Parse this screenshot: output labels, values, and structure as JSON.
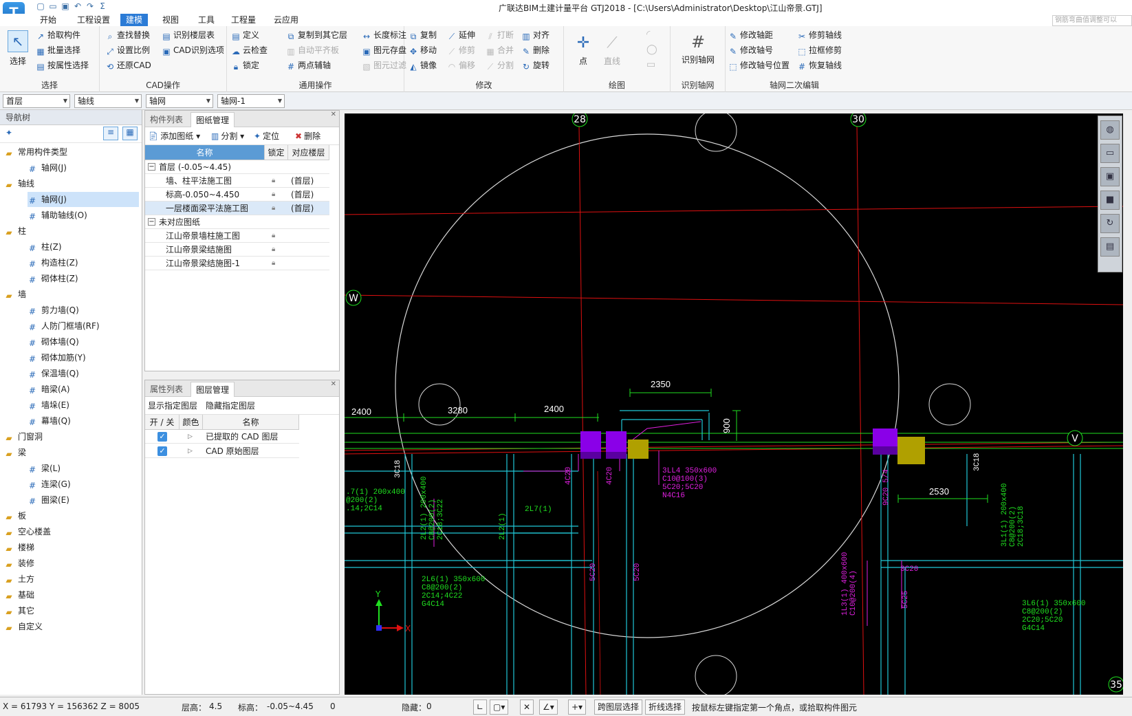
{
  "window": {
    "title": "广联达BIM土建计量平台 GTJ2018 - [C:\\Users\\Administrator\\Desktop\\江山帝景.GTJ]",
    "search_hint": "钢筋弯曲值调整可以"
  },
  "app_logo": "T",
  "menu": [
    "开始",
    "工程设置",
    "建模",
    "视图",
    "工具",
    "工程量",
    "云应用"
  ],
  "ribbon": {
    "select": {
      "big": "选择",
      "items": [
        "拾取构件",
        "批量选择",
        "按属性选择"
      ],
      "label": "选择"
    },
    "cad": {
      "items": [
        "查找替换",
        "识别楼层表",
        "设置比例",
        "CAD识别选项",
        "还原CAD"
      ],
      "label": "CAD操作"
    },
    "common": {
      "items": [
        "定义",
        "复制到其它层",
        "长度标注",
        "云检查",
        "自动平齐板",
        "图元存盘",
        "锁定",
        "两点辅轴",
        "图元过滤"
      ],
      "label": "通用操作"
    },
    "modify": {
      "items": [
        "复制",
        "延伸",
        "打断",
        "对齐",
        "移动",
        "修剪",
        "合并",
        "删除",
        "镜像",
        "偏移",
        "分割",
        "旋转"
      ],
      "label": "修改"
    },
    "draw": {
      "items": [
        "点",
        "直线"
      ],
      "label": "绘图"
    },
    "recog": {
      "big": "识别轴网",
      "label": "识别轴网"
    },
    "axis2": {
      "items": [
        "修改轴距",
        "修剪轴线",
        "修改轴号",
        "拉框修剪",
        "修改轴号位置",
        "恢复轴线"
      ],
      "label": "轴网二次编辑"
    }
  },
  "selectors": [
    "首层",
    "轴线",
    "轴网",
    "轴网-1"
  ],
  "nav": {
    "title": "导航树",
    "items": [
      {
        "label": "常用构件类型",
        "type": "folder"
      },
      {
        "label": "轴网(J)",
        "type": "leaf"
      },
      {
        "label": "轴线",
        "type": "folder"
      },
      {
        "label": "轴网(J)",
        "type": "leaf",
        "selected": true
      },
      {
        "label": "辅助轴线(O)",
        "type": "leaf"
      },
      {
        "label": "柱",
        "type": "folder"
      },
      {
        "label": "柱(Z)",
        "type": "leaf"
      },
      {
        "label": "构造柱(Z)",
        "type": "leaf"
      },
      {
        "label": "砌体柱(Z)",
        "type": "leaf"
      },
      {
        "label": "墙",
        "type": "folder"
      },
      {
        "label": "剪力墙(Q)",
        "type": "leaf"
      },
      {
        "label": "人防门框墙(RF)",
        "type": "leaf"
      },
      {
        "label": "砌体墙(Q)",
        "type": "leaf"
      },
      {
        "label": "砌体加筋(Y)",
        "type": "leaf"
      },
      {
        "label": "保温墙(Q)",
        "type": "leaf"
      },
      {
        "label": "暗梁(A)",
        "type": "leaf"
      },
      {
        "label": "墙垛(E)",
        "type": "leaf"
      },
      {
        "label": "幕墙(Q)",
        "type": "leaf"
      },
      {
        "label": "门窗洞",
        "type": "folder"
      },
      {
        "label": "梁",
        "type": "folder"
      },
      {
        "label": "梁(L)",
        "type": "leaf"
      },
      {
        "label": "连梁(G)",
        "type": "leaf"
      },
      {
        "label": "圈梁(E)",
        "type": "leaf"
      },
      {
        "label": "板",
        "type": "folder"
      },
      {
        "label": "空心楼盖",
        "type": "folder"
      },
      {
        "label": "楼梯",
        "type": "folder"
      },
      {
        "label": "装修",
        "type": "folder"
      },
      {
        "label": "土方",
        "type": "folder"
      },
      {
        "label": "基础",
        "type": "folder"
      },
      {
        "label": "其它",
        "type": "folder"
      },
      {
        "label": "自定义",
        "type": "folder"
      }
    ]
  },
  "drawings_panel": {
    "tabs": [
      "构件列表",
      "图纸管理"
    ],
    "tools": [
      "添加图纸",
      "分割",
      "定位",
      "删除"
    ],
    "headers": [
      "名称",
      "锁定",
      "对应楼层"
    ],
    "rows": [
      {
        "name": "首层 (-0.05~4.45)",
        "group": true,
        "floor": ""
      },
      {
        "name": "墙、柱平法施工图",
        "group": false,
        "floor": "(首层)"
      },
      {
        "name": "标高-0.050~4.450",
        "group": false,
        "floor": "(首层)"
      },
      {
        "name": "一层楼面梁平法施工图",
        "group": false,
        "floor": "(首层)",
        "selected": true
      },
      {
        "name": "未对应图纸",
        "group": true,
        "floor": ""
      },
      {
        "name": "江山帝景墙柱施工图",
        "group": false,
        "floor": ""
      },
      {
        "name": "江山帝景梁结施图",
        "group": false,
        "floor": ""
      },
      {
        "name": "江山帝景梁结施图-1",
        "group": false,
        "floor": ""
      }
    ]
  },
  "layers_panel": {
    "tabs": [
      "属性列表",
      "图层管理"
    ],
    "tools": [
      "显示指定图层",
      "隐藏指定图层"
    ],
    "headers": [
      "开 / 关",
      "颜色",
      "名称"
    ],
    "rows": [
      {
        "checked": true,
        "name": "已提取的 CAD 图层"
      },
      {
        "checked": true,
        "name": "CAD 原始图层"
      }
    ]
  },
  "cad": {
    "axis_labels": [
      "28",
      "30",
      "W",
      "V",
      "35"
    ],
    "dims": [
      "2350",
      "2400",
      "3280",
      "2400",
      "900",
      "2530"
    ],
    "annotations": [
      "3C18",
      "4C20",
      "4C20",
      "3LL4 350x600",
      "C10@100(3)",
      "5C20;5C20",
      "N4C16",
      "9C20 5/4",
      "3C18",
      ".7(1) 200x400",
      "@200(2)",
      ".14;2C14",
      "2L2(1) 200x400",
      "C8@200(2)",
      "2C18;3C22",
      "2L7(1)",
      "2L2(1)",
      "2L6(1) 350x600",
      "C8@200(2)",
      "2C14;4C22",
      "G4C14",
      "5C20",
      "5C20",
      "3L1(1) 200x400",
      "C8@200(2)",
      "2C18;3C18",
      "3C20",
      "5C25",
      "3L6(1) 350x600",
      "C8@200(2)",
      "2C20;5C20",
      "G4C14",
      "1L3(1) 400x600",
      "C10@200(4)"
    ],
    "axis_x": "X",
    "axis_y": "Y",
    "colors": {
      "bg": "#000000",
      "axis": "#e01010",
      "beam": "#20e020",
      "cyan": "#20c8d8",
      "dim": "#20e020",
      "col_purple": "#8a00e8",
      "col_olive": "#b0a000",
      "label_magenta": "#e020e0",
      "circle": "#d8d8d8"
    }
  },
  "view_tools": [
    "sphere-icon",
    "2d-icon",
    "cube-icon",
    "cube-solid-icon",
    "rotate-icon",
    "layers-icon"
  ],
  "status": {
    "coords": "X = 61793 Y = 156362 Z = 8005",
    "floor_height_label": "层高：",
    "floor_height": "4.5",
    "elev_label": "标高：",
    "elev": "-0.05~4.45",
    "count": "0",
    "hidden_label": "隐藏：",
    "hidden": "0",
    "btn_cross_layer": "跨图层选择",
    "btn_polyline": "折线选择",
    "hint": "按鼠标左键指定第一个角点，或拾取构件图元"
  }
}
